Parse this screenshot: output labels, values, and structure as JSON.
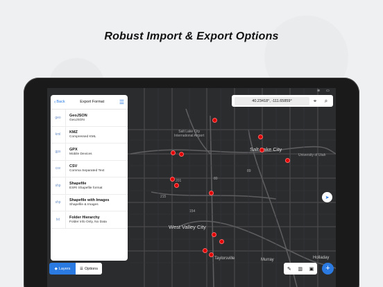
{
  "headline": "Robust Import & Export Options",
  "status_bar": {
    "wifi": "≋",
    "battery": "▭"
  },
  "panel": {
    "back_label": "Back",
    "title": "Export Format",
    "formats": [
      {
        "ext": "geo",
        "name": "GeoJSON",
        "desc": "GeoJSON"
      },
      {
        "ext": "kml",
        "name": "KMZ",
        "desc": "Compressed KML"
      },
      {
        "ext": "gpx",
        "name": "GPX",
        "desc": "Mobile Devices"
      },
      {
        "ext": "csv",
        "name": "CSV",
        "desc": "Comma Separated Text"
      },
      {
        "ext": "shp",
        "name": "Shapefile",
        "desc": "ESRI Shapefile format"
      },
      {
        "ext": "shp",
        "name": "Shapefile with Images",
        "desc": "Shapefile & Images"
      },
      {
        "ext": "txt",
        "name": "Folder Hierarchy",
        "desc": "Folder info Only, No Data"
      }
    ]
  },
  "search": {
    "coordinates": "40.23418°, -111.65859°"
  },
  "bottom": {
    "layers_label": "Layers",
    "options_label": "Options"
  },
  "map_labels": {
    "airport": "Salt Lake City\nInternational Airport",
    "slc": "Salt Lake City",
    "university": "University of Utah",
    "west_valley": "West Valley City",
    "taylorsville": "Taylorsville",
    "murray": "Murray",
    "holladay": "Holladay",
    "highway_215": "215",
    "highway_80": "80",
    "highway_154": "154",
    "highway_201": "201",
    "highway_89": "89"
  },
  "colors": {
    "accent": "#2a7ae2",
    "pin": "#e00000",
    "map_bg": "#2b2c2e"
  }
}
